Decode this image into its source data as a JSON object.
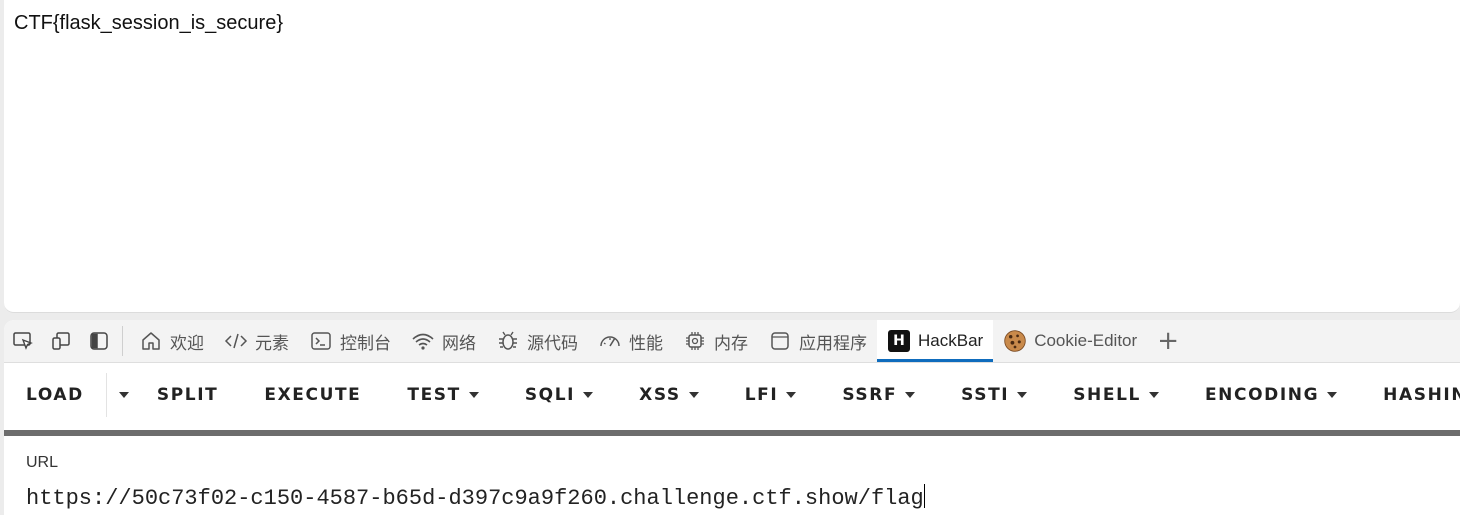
{
  "page": {
    "content_text": "CTF{flask_session_is_secure}"
  },
  "devtools": {
    "tabs": [
      {
        "label": "欢迎",
        "icon": "home-icon"
      },
      {
        "label": "元素",
        "icon": "code-icon"
      },
      {
        "label": "控制台",
        "icon": "console-icon"
      },
      {
        "label": "网络",
        "icon": "wifi-icon"
      },
      {
        "label": "源代码",
        "icon": "bug-icon"
      },
      {
        "label": "性能",
        "icon": "gauge-icon"
      },
      {
        "label": "内存",
        "icon": "chip-icon"
      },
      {
        "label": "应用程序",
        "icon": "app-icon"
      },
      {
        "label": "HackBar",
        "icon": "hackbar-icon",
        "active": true
      },
      {
        "label": "Cookie-Editor",
        "icon": "cookie-icon"
      }
    ],
    "hackbar_logo_letter": "H",
    "add_tab_symbol": "+",
    "accent_color": "#0f6cbd"
  },
  "hackbar": {
    "toolbar": {
      "load": "LOAD",
      "split": "SPLIT",
      "execute": "EXECUTE",
      "test": "TEST",
      "sqli": "SQLI",
      "xss": "XSS",
      "lfi": "LFI",
      "ssrf": "SSRF",
      "ssti": "SSTI",
      "shell": "SHELL",
      "encoding": "ENCODING",
      "hashing": "HASHIN"
    },
    "url_label": "URL",
    "url_value": "https://50c73f02-c150-4587-b65d-d397c9a9f260.challenge.ctf.show/flag"
  }
}
